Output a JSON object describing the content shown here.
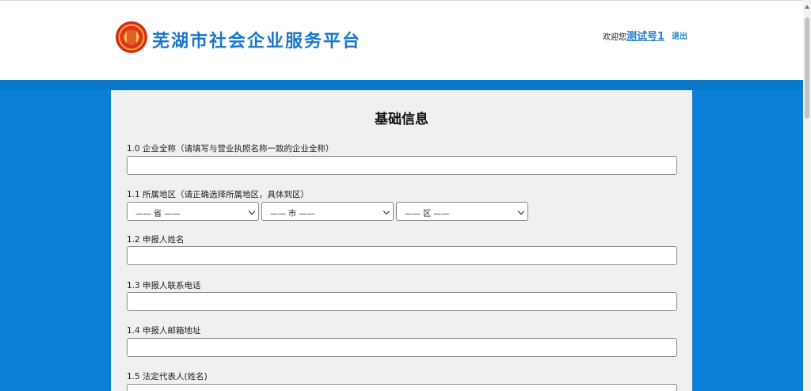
{
  "header": {
    "site_title": "芜湖市社会企业服务平台",
    "logo_icon": "emblem-logo-icon",
    "welcome_text": "欢迎您",
    "username": "测试号1",
    "logout_label": "退出"
  },
  "form": {
    "title": "基础信息",
    "fields": [
      {
        "label": "1.0 企业全称（请填写与营业执照名称一致的企业全称）",
        "value": ""
      },
      {
        "label": "1.1 所属地区（请正确选择所属地区，具体到区）"
      },
      {
        "label": "1.2 申报人姓名",
        "value": ""
      },
      {
        "label": "1.3 申报人联系电话",
        "value": ""
      },
      {
        "label": "1.4 申报人邮箱地址",
        "value": ""
      },
      {
        "label": "1.5 法定代表人(姓名)",
        "value": ""
      }
    ],
    "region_selects": {
      "province": "—— 省 ——",
      "city": "—— 市 ——",
      "district": "—— 区 ——"
    }
  },
  "colors": {
    "page_bg": "#0a7fd6",
    "accent": "#1977c8",
    "panel_bg": "#f0f0f0"
  }
}
